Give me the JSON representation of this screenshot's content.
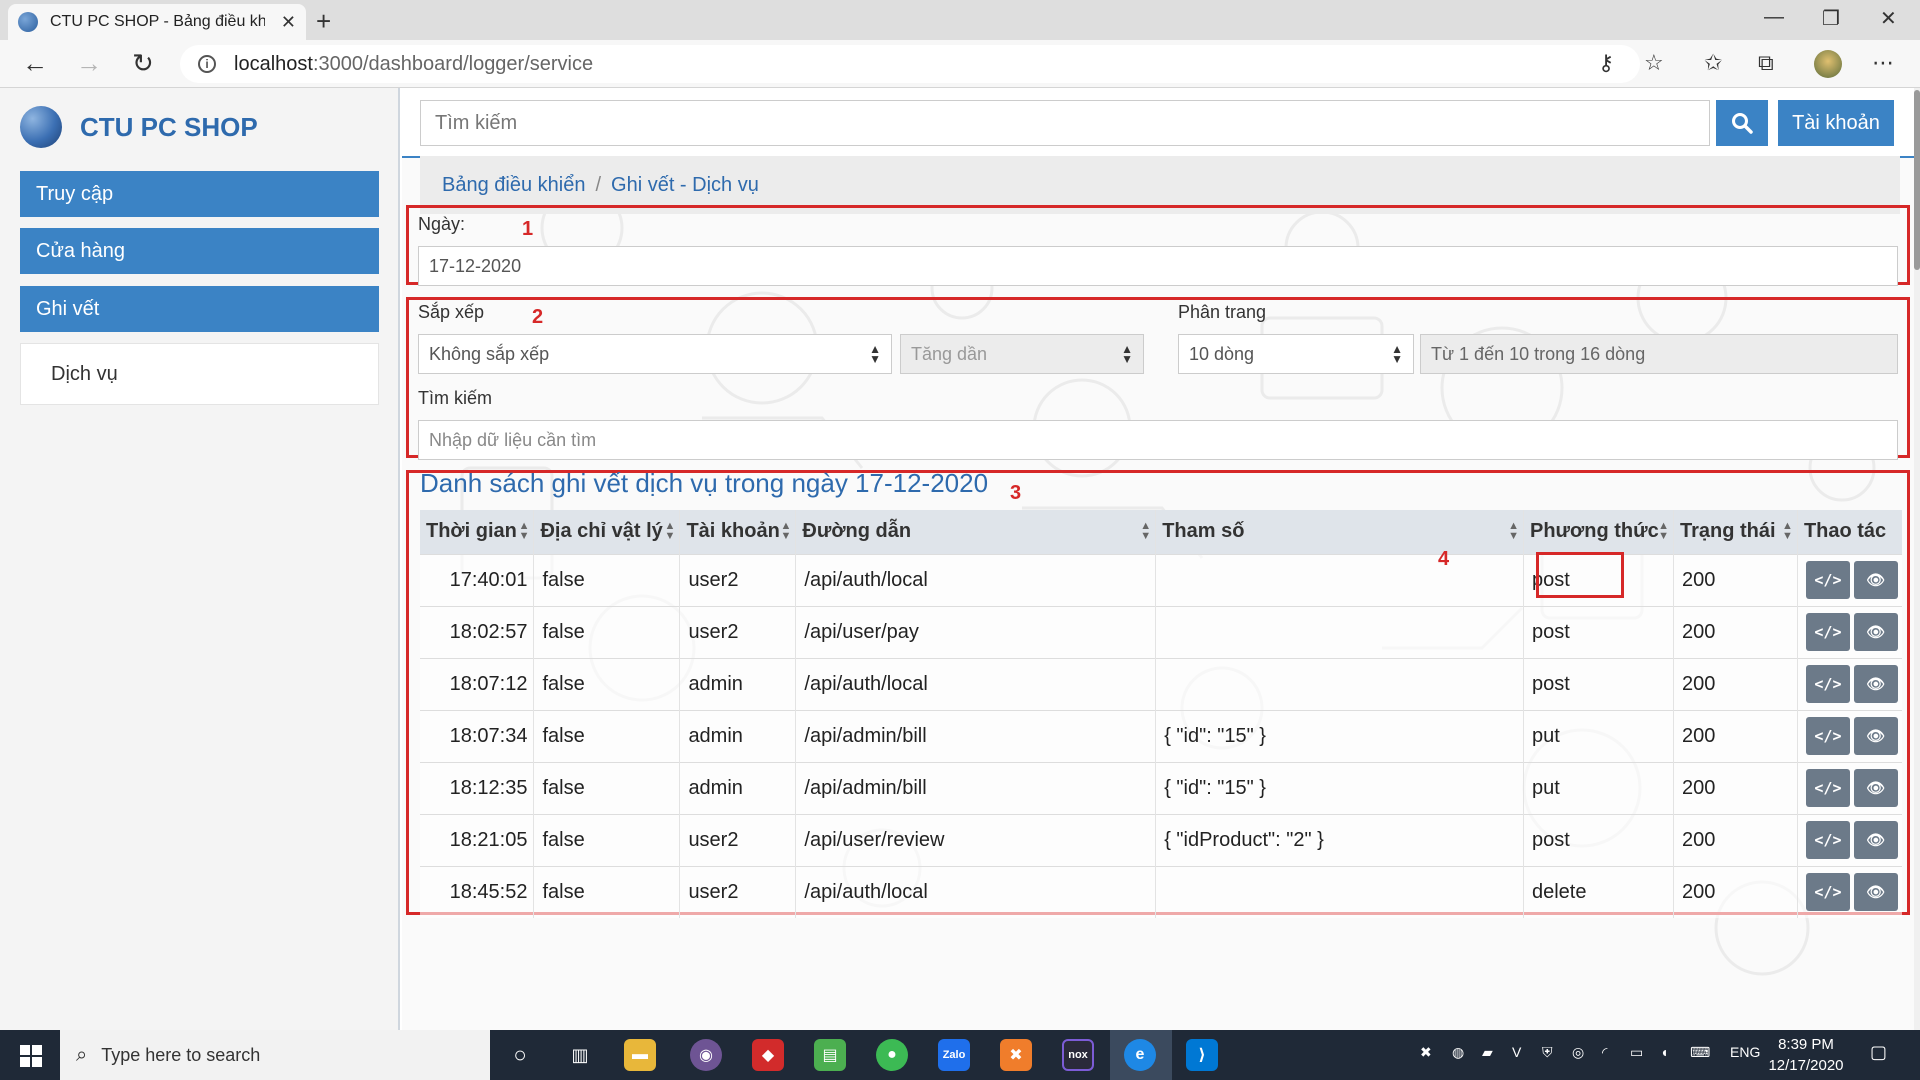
{
  "browser": {
    "tab_title": "CTU PC SHOP - Bảng điều khiển",
    "url_host": "localhost",
    "url_rest": ":3000/dashboard/logger/service"
  },
  "sidebar": {
    "brand": "CTU PC SHOP",
    "items": [
      {
        "label": "Truy cập"
      },
      {
        "label": "Cửa hàng"
      },
      {
        "label": "Ghi vết"
      }
    ],
    "sub_item": "Dịch vụ"
  },
  "topbar": {
    "search_placeholder": "Tìm kiếm",
    "account_label": "Tài khoản"
  },
  "breadcrumb": {
    "home": "Bảng điều khiển",
    "current": "Ghi vết - Dịch vụ"
  },
  "annotations": [
    "1",
    "2",
    "3",
    "4"
  ],
  "date_section": {
    "label": "Ngày:",
    "value": "17-12-2020"
  },
  "filter_section": {
    "sort_label": "Sắp xếp",
    "sort_value": "Không sắp xếp",
    "order_value": "Tăng dần",
    "paging_label": "Phân trang",
    "paging_value": "10 dòng",
    "paging_info": "Từ 1 đến 10 trong 16 dòng",
    "search_label": "Tìm kiếm",
    "search_placeholder": "Nhập dữ liệu cần tìm"
  },
  "list": {
    "title": "Danh sách ghi vết dịch vụ trong ngày 17-12-2020",
    "columns": [
      "Thời gian",
      "Địa chỉ vật lý",
      "Tài khoản",
      "Đường dẫn",
      "Tham số",
      "Phương thức",
      "Trạng thái",
      "Thao tác"
    ],
    "rows": [
      {
        "time": "17:40:01",
        "physical": "false",
        "account": "user2",
        "path": "/api/auth/local",
        "params": "",
        "method": "post",
        "status": "200"
      },
      {
        "time": "18:02:57",
        "physical": "false",
        "account": "user2",
        "path": "/api/user/pay",
        "params": "",
        "method": "post",
        "status": "200"
      },
      {
        "time": "18:07:12",
        "physical": "false",
        "account": "admin",
        "path": "/api/auth/local",
        "params": "",
        "method": "post",
        "status": "200"
      },
      {
        "time": "18:07:34",
        "physical": "false",
        "account": "admin",
        "path": "/api/admin/bill",
        "params": "{ \"id\": \"15\" }",
        "method": "put",
        "status": "200"
      },
      {
        "time": "18:12:35",
        "physical": "false",
        "account": "admin",
        "path": "/api/admin/bill",
        "params": "{ \"id\": \"15\" }",
        "method": "put",
        "status": "200"
      },
      {
        "time": "18:21:05",
        "physical": "false",
        "account": "user2",
        "path": "/api/user/review",
        "params": "{ \"idProduct\": \"2\" }",
        "method": "post",
        "status": "200"
      },
      {
        "time": "18:45:52",
        "physical": "false",
        "account": "user2",
        "path": "/api/auth/local",
        "params": "",
        "method": "delete",
        "status": "200"
      }
    ]
  },
  "taskbar": {
    "search_placeholder": "Type here to search",
    "lang": "ENG",
    "time": "8:39 PM",
    "date": "12/17/2020"
  },
  "colors": {
    "primary": "#3b83c5",
    "annotation_red": "#d62828",
    "brand_text": "#2e6aad"
  }
}
